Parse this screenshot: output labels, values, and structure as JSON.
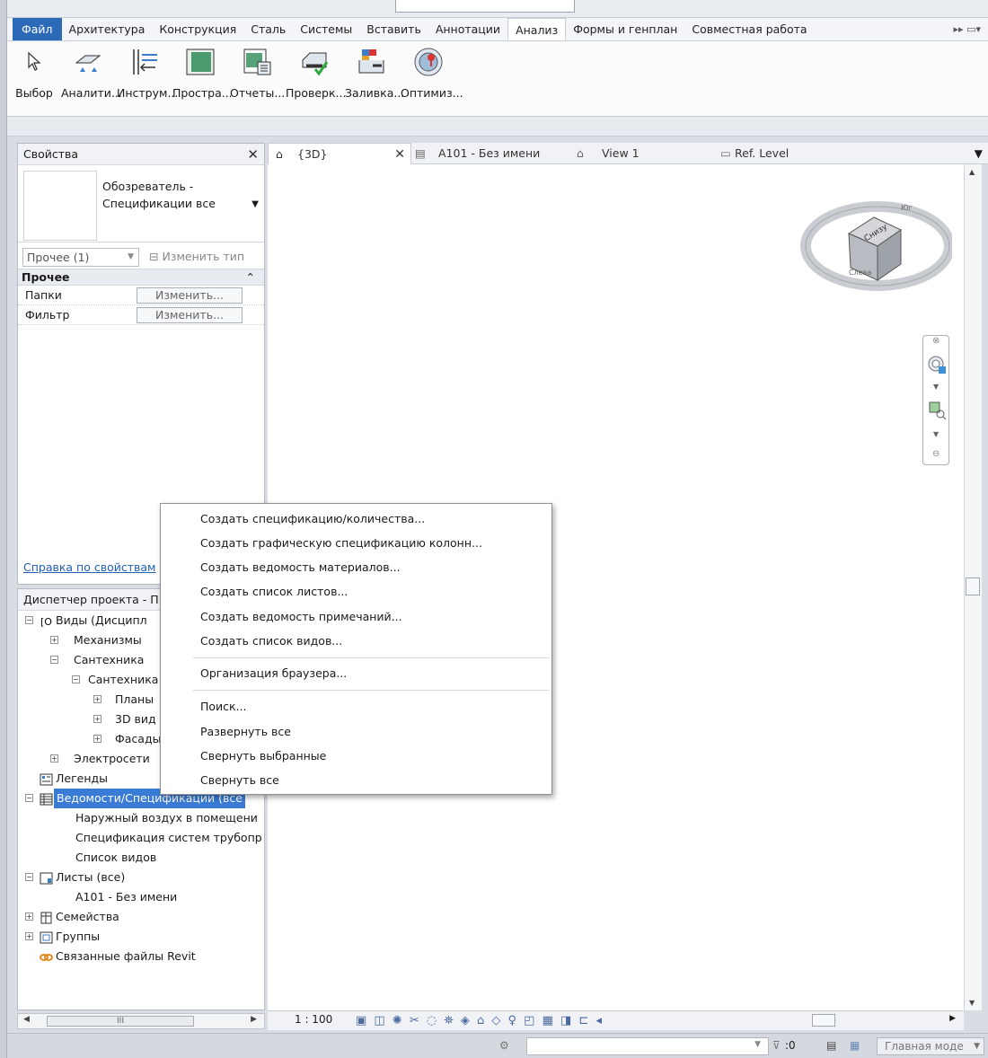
{
  "menubar": {
    "tabs": [
      "Файл",
      "Архитектура",
      "Конструкция",
      "Сталь",
      "Системы",
      "Вставить",
      "Аннотации",
      "Анализ",
      "Формы и генплан",
      "Совместная работа"
    ],
    "active_tab": "Анализ"
  },
  "ribbon": {
    "buttons": [
      "Выбор",
      "Аналити...",
      "Инструм...",
      "Простра...",
      "Отчеты...",
      "Проверк...",
      "Заливка...",
      "Оптимиз..."
    ]
  },
  "properties": {
    "title": "Свойства",
    "type_name": "Обозреватель - Спецификации все",
    "instance_filter": "Прочее (1)",
    "edit_type": "Изменить тип",
    "group": "Прочее",
    "rows": [
      {
        "name": "Папки",
        "value": "Изменить..."
      },
      {
        "name": "Фильтр",
        "value": "Изменить..."
      }
    ],
    "help_link": "Справка по свойствам"
  },
  "browser": {
    "title": "Диспетчер проекта - П",
    "nodes": [
      "Виды (Дисципл",
      "Механизмы",
      "Сантехника",
      "Сантехника",
      "Планы",
      "3D вид",
      "Фасады",
      "Электросети",
      "Легенды",
      "Ведомости/Спецификации (все",
      "Наружный воздух в помещени",
      "Спецификация систем трубопр",
      "Список видов",
      "Листы (все)",
      "А101 - Без имени",
      "Семейства",
      "Группы",
      "Связанные файлы Revit"
    ],
    "hscroll_label": "III"
  },
  "view_tabs": [
    {
      "label": "{3D}"
    },
    {
      "label": "A101 - Без имени"
    },
    {
      "label": "View 1"
    },
    {
      "label": "Ref. Level"
    }
  ],
  "viewcube": {
    "face": "Снизу",
    "ring_south": "Юг",
    "ring_label": "Слева"
  },
  "view_control": {
    "scale": "1 : 100"
  },
  "status": {
    "zero": ":0",
    "model": "Главная моде"
  },
  "context_menu": {
    "items": [
      "Создать спецификацию/количества...",
      "Создать графическую спецификацию колонн...",
      "Создать ведомость материалов...",
      "Создать список листов...",
      "Создать ведомость примечаний...",
      "Создать список видов...",
      "Организация браузера...",
      "Поиск...",
      "Развернуть все",
      "Свернуть выбранные",
      "Свернуть все"
    ]
  },
  "colors": {
    "accent": "#2c6ab8",
    "selection": "#3a7cd5",
    "link": "#1f5fb4"
  }
}
